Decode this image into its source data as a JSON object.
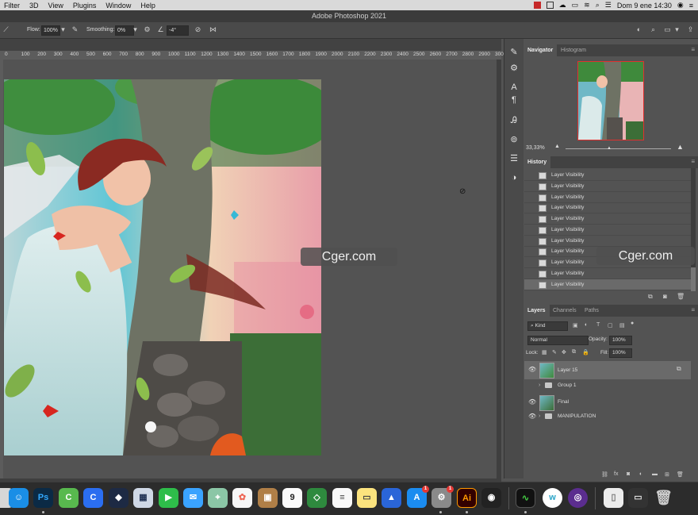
{
  "menubar": {
    "items": [
      "Filter",
      "3D",
      "View",
      "Plugins",
      "Window",
      "Help"
    ],
    "datetime": "Dom 9 ene  14:30"
  },
  "app": {
    "title": "Adobe Photoshop 2021"
  },
  "options": {
    "flow_label": "Flow:",
    "flow_value": "100%",
    "smoothing_label": "Smoothing:",
    "smoothing_value": "0%",
    "angle_value": "-4°"
  },
  "ruler": {
    "labels": [
      "0",
      "100",
      "200",
      "300",
      "400",
      "500",
      "600",
      "700",
      "800",
      "900",
      "1000",
      "1100",
      "1200",
      "1300",
      "1400",
      "1500",
      "1600",
      "1700",
      "1800",
      "1900",
      "2000",
      "2100",
      "2200",
      "2300",
      "2400",
      "2500",
      "2600",
      "2700",
      "2800",
      "2900",
      "3000"
    ]
  },
  "navigator": {
    "tabs": [
      "Navigator",
      "Histogram"
    ],
    "zoom": "33,33%"
  },
  "history": {
    "title": "History",
    "items": [
      "Layer Visibility",
      "Layer Visibility",
      "Layer Visibility",
      "Layer Visibility",
      "Layer Visibility",
      "Layer Visibility",
      "Layer Visibility",
      "Layer Visibility",
      "Layer Visibility",
      "Layer Visibility",
      "Layer Visibility"
    ],
    "selected_index": 10
  },
  "layers": {
    "tabs": [
      "Layers",
      "Channels",
      "Paths"
    ],
    "kind_filter": "Kind",
    "blend_mode": "Normal",
    "opacity_label": "Opacity:",
    "opacity_value": "100%",
    "lock_label": "Lock:",
    "fill_label": "Fill:",
    "fill_value": "100%",
    "items": [
      {
        "name": "Layer 15",
        "type": "layer",
        "selected": true
      },
      {
        "name": "Group 1",
        "type": "group",
        "selected": false
      },
      {
        "name": "Final",
        "type": "layer",
        "selected": false
      },
      {
        "name": "MANIPULATION",
        "type": "group",
        "selected": false
      }
    ]
  },
  "watermarks": [
    "Cger.com",
    "Cger.com"
  ],
  "dock": {
    "apps": [
      "Finder",
      "Photoshop",
      "Cerebro",
      "Copilot",
      "Affinity",
      "Preview",
      "FaceTime",
      "Messages",
      "Maps",
      "Photos",
      "Contacts",
      "Calendar",
      "Reminders",
      "Notes",
      "Vectornator",
      "App Store",
      "System Preferences",
      "Illustrator",
      "Bezel",
      "Activity Monitor",
      "Wunderbucket",
      "Tor",
      "Pages",
      "Disk",
      "Trash"
    ],
    "calendar_day": "9",
    "badges": {
      "appstore": "1",
      "settings": "1"
    }
  }
}
